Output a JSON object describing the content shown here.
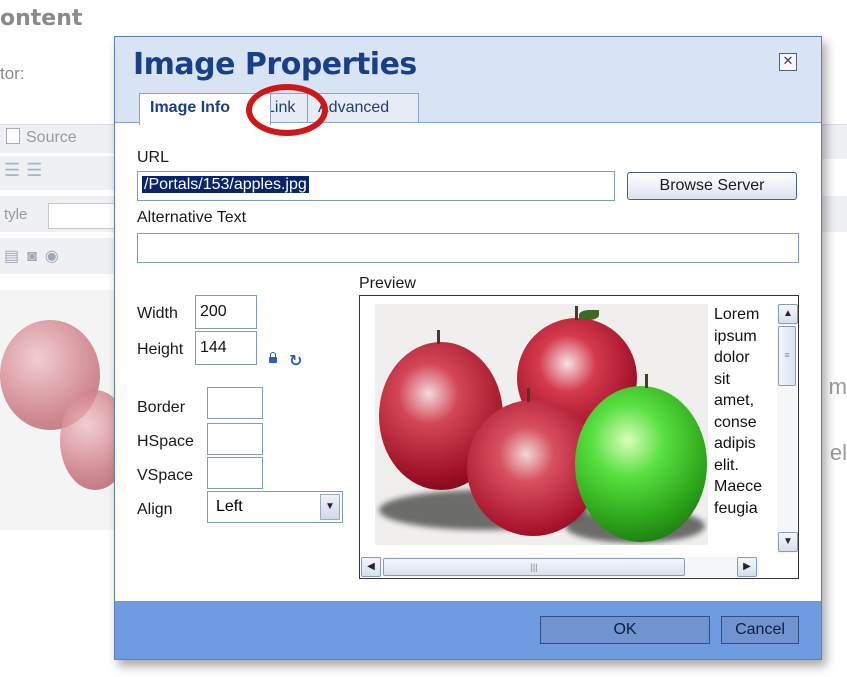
{
  "background": {
    "title": "ontent",
    "editor_label": "tor:",
    "source_label": "Source",
    "style_label": "tyle",
    "right_text_1": "m",
    "right_text_2": "el"
  },
  "dialog": {
    "title": "Image Properties",
    "close_glyph": "✕",
    "tabs": [
      {
        "label": "Image Info",
        "active": true
      },
      {
        "label": "Link",
        "active": false
      },
      {
        "label": "Advanced",
        "active": false
      }
    ],
    "url_label": "URL",
    "url_value": "/Portals/153/apples.jpg",
    "browse_button": "Browse Server",
    "alt_text_label": "Alternative Text",
    "alt_text_value": "",
    "width_label": "Width",
    "width_value": "200",
    "height_label": "Height",
    "height_value": "144",
    "border_label": "Border",
    "border_value": "",
    "hspace_label": "HSpace",
    "hspace_value": "",
    "vspace_label": "VSpace",
    "vspace_value": "",
    "align_label": "Align",
    "align_value": "Left",
    "preview_label": "Preview",
    "preview_text": "Lorem\nipsum\ndolor\nsit\namet,\nconse\nadipis\nelit.\nMaece\nfeugia",
    "ok_button": "OK",
    "cancel_button": "Cancel"
  },
  "icons": {
    "lock": "lock-icon",
    "reset_size": "reset-size-icon",
    "close": "close-icon"
  },
  "colors": {
    "dialog_frame": "#6f9be0",
    "header_bg": "#d8e4f4",
    "title": "#1a3f8a",
    "highlight_ring": "#cc1818",
    "url_selection": "#0a246a"
  }
}
